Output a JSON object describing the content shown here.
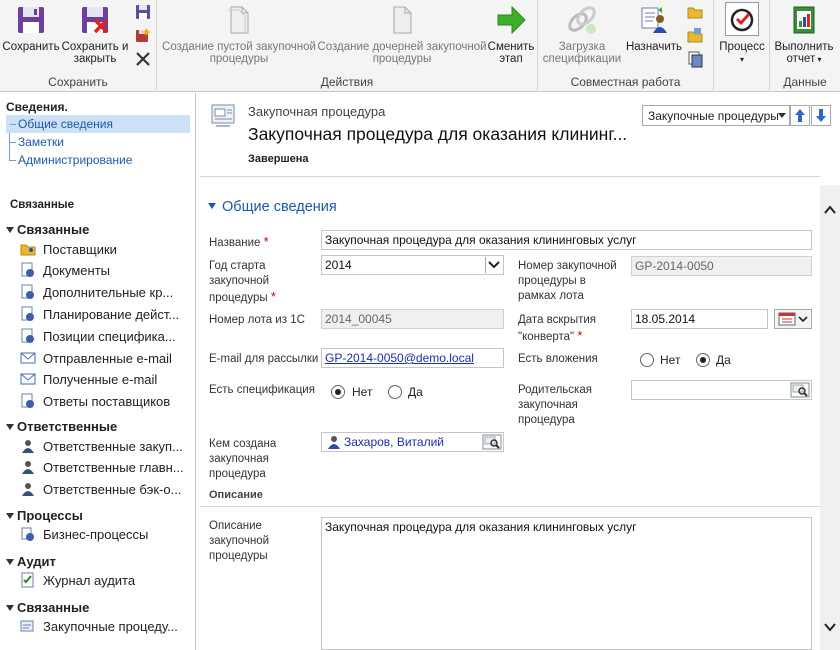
{
  "ribbon": {
    "groups": {
      "save": "Сохранить",
      "actions": "Действия",
      "collab": "Совместная работа",
      "data": "Данные"
    },
    "buttons": {
      "save": "Сохранить",
      "save_close_1": "Сохранить и",
      "save_close_2": "закрыть",
      "create_empty_1": "Создание пустой закупочной",
      "create_empty_2": "процедуры",
      "create_child_1": "Создание дочерней закупочной",
      "create_child_2": "процедуры",
      "change_stage_1": "Сменить",
      "change_stage_2": "этап",
      "upload_spec_1": "Загрузка",
      "upload_spec_2": "спецификации",
      "assign": "Назначить",
      "process": "Процесс",
      "run_report_1": "Выполнить",
      "run_report_2": "отчет"
    }
  },
  "sidebar": {
    "info_header": "Сведения.",
    "info_items": [
      "Общие сведения",
      "Заметки",
      "Администрирование"
    ],
    "related_header": "Связанные",
    "groups": [
      {
        "title": "Связанные",
        "items": [
          "Поставщики",
          "Документы",
          "Дополнительные кр...",
          "Планирование дейст...",
          "Позиции специфика...",
          "Отправленные e-mail",
          "Полученные e-mail",
          "Ответы поставщиков"
        ]
      },
      {
        "title": "Ответственные",
        "items": [
          "Ответственные закуп...",
          "Ответственные главн...",
          "Ответственные бэк-о..."
        ]
      },
      {
        "title": "Процессы",
        "items": [
          "Бизнес-процессы"
        ]
      },
      {
        "title": "Аудит",
        "items": [
          "Журнал аудита"
        ]
      },
      {
        "title": "Связанные",
        "items": [
          "Закупочные процеду..."
        ]
      }
    ]
  },
  "header": {
    "entity_type": "Закупочная процедура",
    "title": "Закупочная процедура для оказания клининг...",
    "status": "Завершена",
    "view_selector": "Закупочные процедуры"
  },
  "form": {
    "section_title": "Общие сведения",
    "name_label": "Название",
    "name_value": "Закупочная процедура для оказания клининговых услуг",
    "year_label_1": "Год старта",
    "year_label_2": "закупочной",
    "year_label_3": "процедуры",
    "year_value": "2014",
    "lot_proc_label_1": "Номер закупочной",
    "lot_proc_label_2": "процедуры в",
    "lot_proc_label_3": "рамках лота",
    "lot_proc_value": "GP-2014-0050",
    "lot1c_label": "Номер лота из 1С",
    "lot1c_value": "2014_00045",
    "open_date_label_1": "Дата вскрытия",
    "open_date_label_2": "\"конверта\"",
    "open_date_value": "18.05.2014",
    "email_label": "E-mail для рассылки",
    "email_value": "GP-2014-0050@demo.local",
    "attachments_label": "Есть вложения",
    "spec_label": "Есть спецификация",
    "radio_no": "Нет",
    "radio_yes": "Да",
    "parent_label_1": "Родительская",
    "parent_label_2": "закупочная",
    "parent_label_3": "процедура",
    "parent_value": "",
    "created_by_label_1": "Кем создана",
    "created_by_label_2": "закупочная",
    "created_by_label_3": "процедура",
    "created_by_value": "Захаров, Виталий",
    "description_subsection": "Описание",
    "description_label_1": "Описание",
    "description_label_2": "закупочной",
    "description_label_3": "процедуры",
    "description_value": "Закупочная процедура для оказания клининговых услуг"
  },
  "state": {
    "attachments": "yes",
    "specification": "no"
  },
  "colors": {
    "accent": "#1d5aa6",
    "required": "#cc0000",
    "selected_nav": "#cde0f5"
  }
}
